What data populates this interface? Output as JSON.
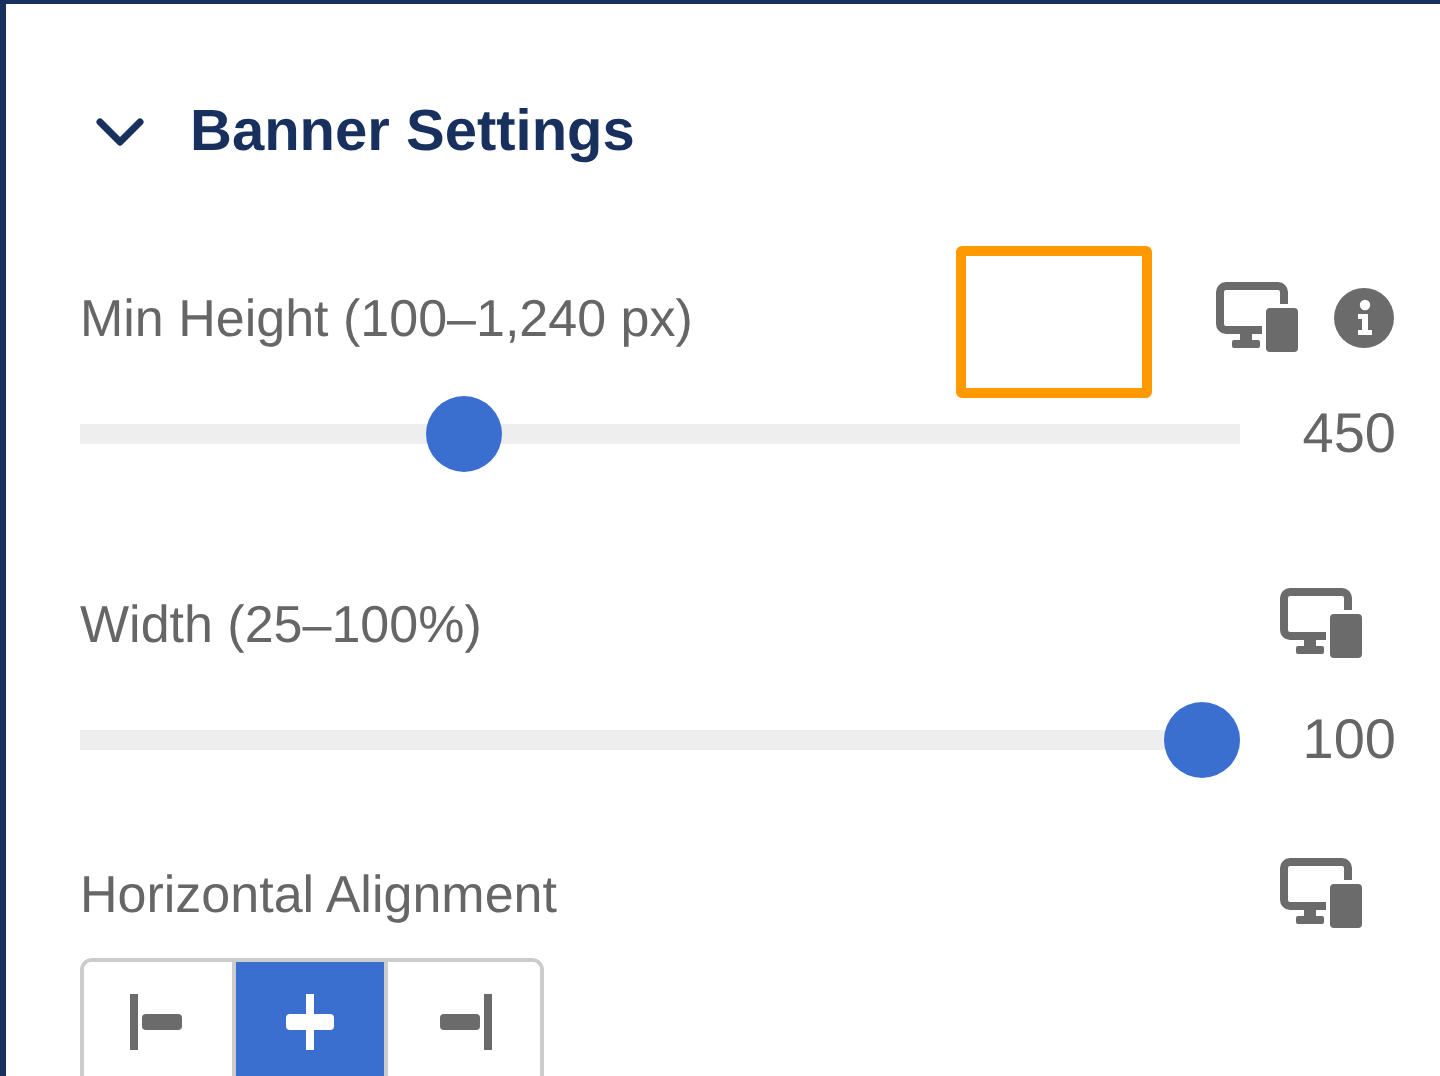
{
  "section": {
    "title": "Banner Settings",
    "expanded": true
  },
  "sliders": [
    {
      "label": "Min Height (100–1,240 px)",
      "level": 0.32,
      "reading": "450",
      "highlighted": true,
      "info": true
    },
    {
      "label": "Width (25–100%)",
      "level": 1,
      "reading": "100",
      "highlighted": false,
      "info": false
    }
  ],
  "alignment": {
    "label": "Horizontal Alignment",
    "options": [
      {
        "kind": "left",
        "selected": false
      },
      {
        "kind": "center",
        "selected": true
      },
      {
        "kind": "right",
        "selected": false
      }
    ]
  }
}
